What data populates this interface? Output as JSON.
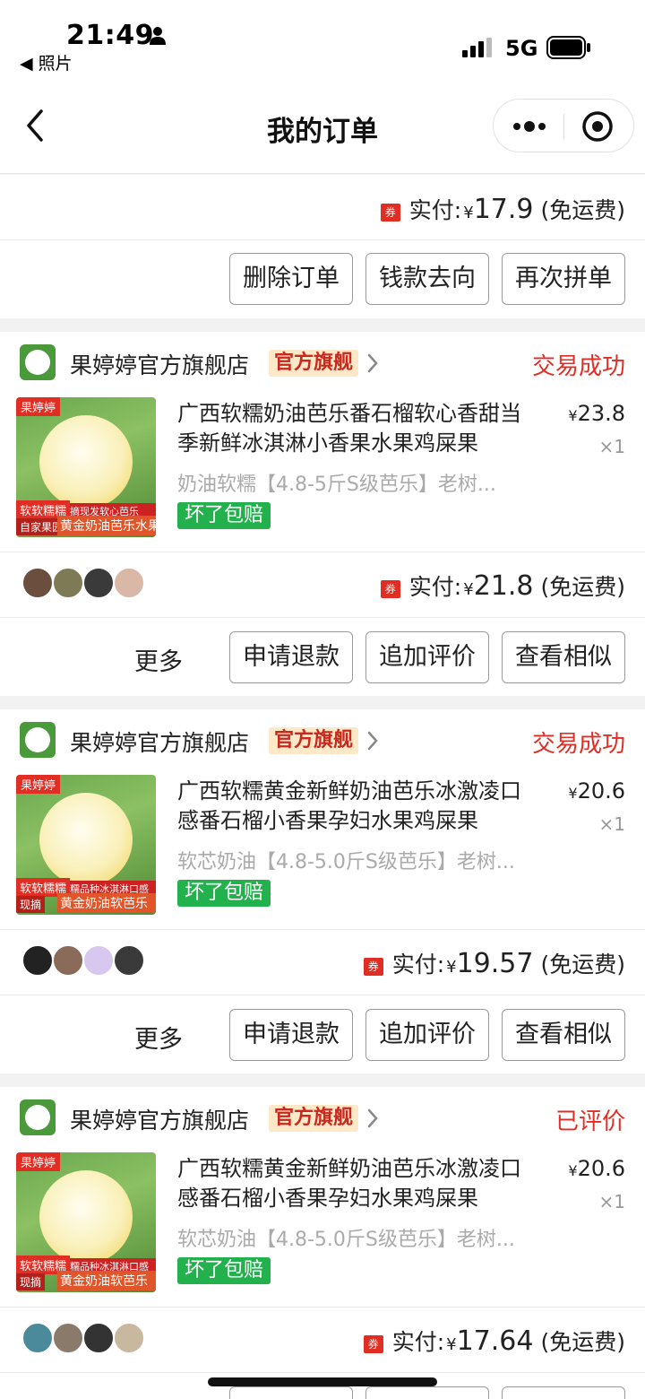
{
  "status_bar": {
    "time": "21:49",
    "back_app": "◀ 照片",
    "network": "5G"
  },
  "nav": {
    "title": "我的订单"
  },
  "top_order": {
    "pay_label": "实付:",
    "currency": "¥",
    "amount": "17.9",
    "shipping": "(免运费)",
    "buttons": [
      "删除订单",
      "钱款去向",
      "再次拼单"
    ]
  },
  "orders": [
    {
      "shop_name": "果婷婷官方旗舰店",
      "shop_tag": "官方旗舰",
      "status": "交易成功",
      "product_title": "广西软糯奶油芭乐番石榴软心香甜当季新鲜冰淇淋小香果水果鸡屎果",
      "spec": "奶油软糯【4.8-5斤S级芭乐】老树...",
      "badge": "坏了包赔",
      "price": "23.8",
      "qty": "×1",
      "thumb_tl": "果婷婷",
      "thumb_bl": "软软糯糯",
      "thumb_bl2": "自家果园",
      "thumb_br": "黄金奶油芭乐水果",
      "thumb_br2": "现摘现发软心芭乐",
      "pay_label": "实付:",
      "amount": "21.8",
      "shipping": "(免运费)",
      "more": "更多",
      "buttons": [
        "申请退款",
        "追加评价",
        "查看相似"
      ],
      "status_color": "#e02e24"
    },
    {
      "shop_name": "果婷婷官方旗舰店",
      "shop_tag": "官方旗舰",
      "status": "交易成功",
      "product_title": "广西软糯黄金新鲜奶油芭乐冰激凌口感番石榴小香果孕妇水果鸡屎果",
      "spec": "软芯奶油【4.8-5.0斤S级芭乐】老树...",
      "badge": "坏了包赔",
      "price": "20.6",
      "qty": "×1",
      "thumb_tl": "果婷婷",
      "thumb_bl": "软软糯糯",
      "thumb_bl2": "现摘",
      "thumb_br": "黄金奶油软芭乐",
      "thumb_br2": "软糯品种冰淇淋口感",
      "pay_label": "实付:",
      "amount": "19.57",
      "shipping": "(免运费)",
      "more": "更多",
      "buttons": [
        "申请退款",
        "追加评价",
        "查看相似"
      ],
      "status_color": "#e02e24"
    },
    {
      "shop_name": "果婷婷官方旗舰店",
      "shop_tag": "官方旗舰",
      "status": "已评价",
      "product_title": "广西软糯黄金新鲜奶油芭乐冰激凌口感番石榴小香果孕妇水果鸡屎果",
      "spec": "软芯奶油【4.8-5.0斤S级芭乐】老树...",
      "badge": "坏了包赔",
      "price": "20.6",
      "qty": "×1",
      "thumb_tl": "果婷婷",
      "thumb_bl": "软软糯糯",
      "thumb_bl2": "现摘",
      "thumb_br": "黄金奶油软芭乐",
      "thumb_br2": "软糯品种冰淇淋口感",
      "pay_label": "实付:",
      "amount": "17.64",
      "shipping": "(免运费)",
      "status_color": "#e02e24"
    }
  ],
  "currency": "¥",
  "coupon_icon": "券",
  "colors": {
    "accent_red": "#e02e24",
    "badge_green": "#22b14c",
    "tag_bg": "#fde8c8"
  }
}
